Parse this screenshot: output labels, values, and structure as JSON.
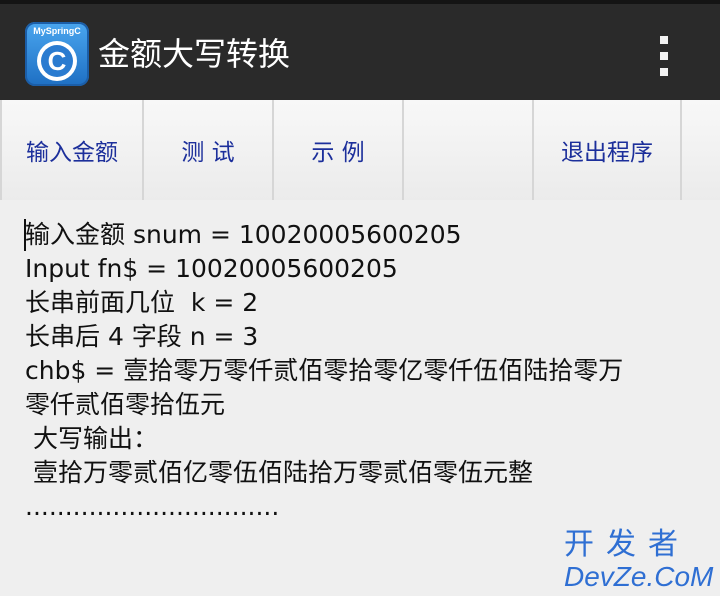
{
  "app_bar": {
    "icon_brand": "MySpringC",
    "icon_letter": "C",
    "title": "金额大写转换"
  },
  "toolbar": {
    "buttons": [
      "输入金额",
      "测  试",
      "示  例",
      "",
      "退出程序",
      ""
    ]
  },
  "console": {
    "lines": [
      "输入金额 snum = 10020005600205",
      "Input fn$ = 10020005600205",
      "长串前面几位  k = 2",
      "长串后 4 字段 n = 3",
      "chb$ = 壹拾零万零仟贰佰零拾零亿零仟伍佰陆拾零万",
      "零仟贰佰零拾伍元",
      " 大写输出：",
      " 壹拾万零贰佰亿零伍佰陆拾万零贰佰零伍元整",
      "................................"
    ]
  },
  "watermark": {
    "cn": "开发者",
    "en": "DevZe.CoM"
  },
  "colors": {
    "app_bar": "#2a2a2a",
    "button_text": "#1c2f9b",
    "console_text": "#111111",
    "watermark": "#2f6fd3"
  },
  "icons": {
    "app": "myspringc-app-icon",
    "menu": "overflow-menu-icon"
  }
}
